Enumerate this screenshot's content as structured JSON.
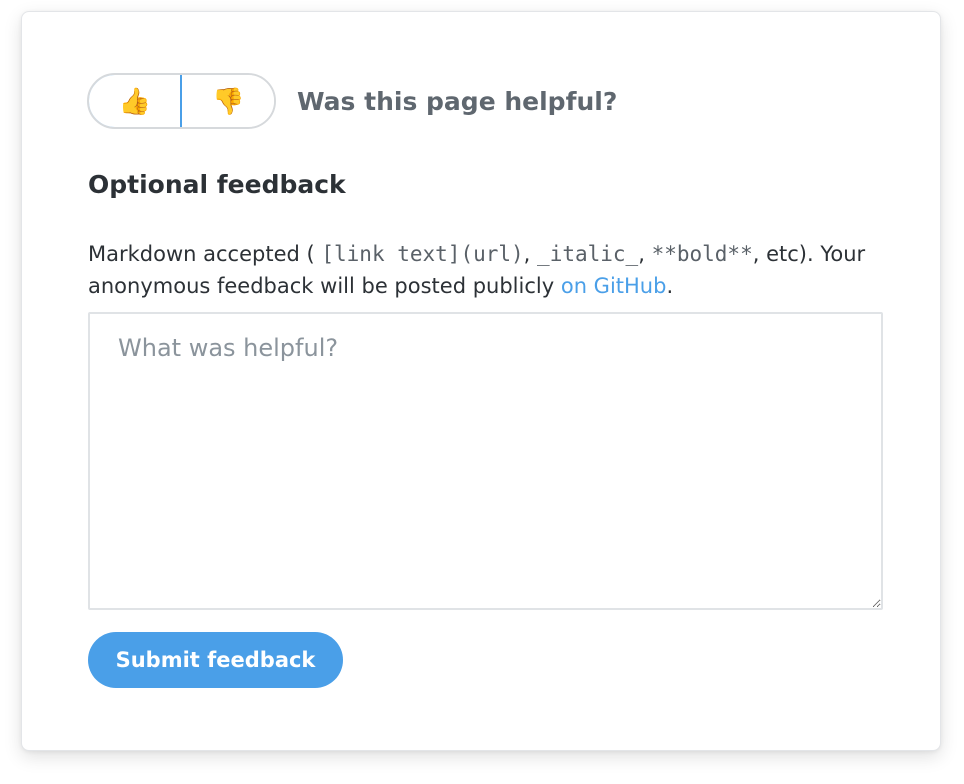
{
  "vote": {
    "up_icon": "thumbs-up-icon",
    "up_glyph": "👍",
    "down_icon": "thumbs-down-icon",
    "down_glyph": "👎",
    "question": "Was this page helpful?"
  },
  "feedback": {
    "heading": "Optional feedback",
    "desc_intro": "Markdown accepted (",
    "code_link": "[link text](url)",
    "sep1": ",",
    "code_italic": "_italic_",
    "sep2": ",",
    "code_bold": "**bold**",
    "desc_mid": ", etc). Your anonymous feedback will be posted publicly",
    "link_text": "on GitHub",
    "desc_end": ".",
    "placeholder": "What was helpful?",
    "value": "",
    "submit_label": "Submit feedback"
  },
  "colors": {
    "accent": "#4a9fe8",
    "heading": "#2c3136",
    "muted": "#5f676f"
  }
}
